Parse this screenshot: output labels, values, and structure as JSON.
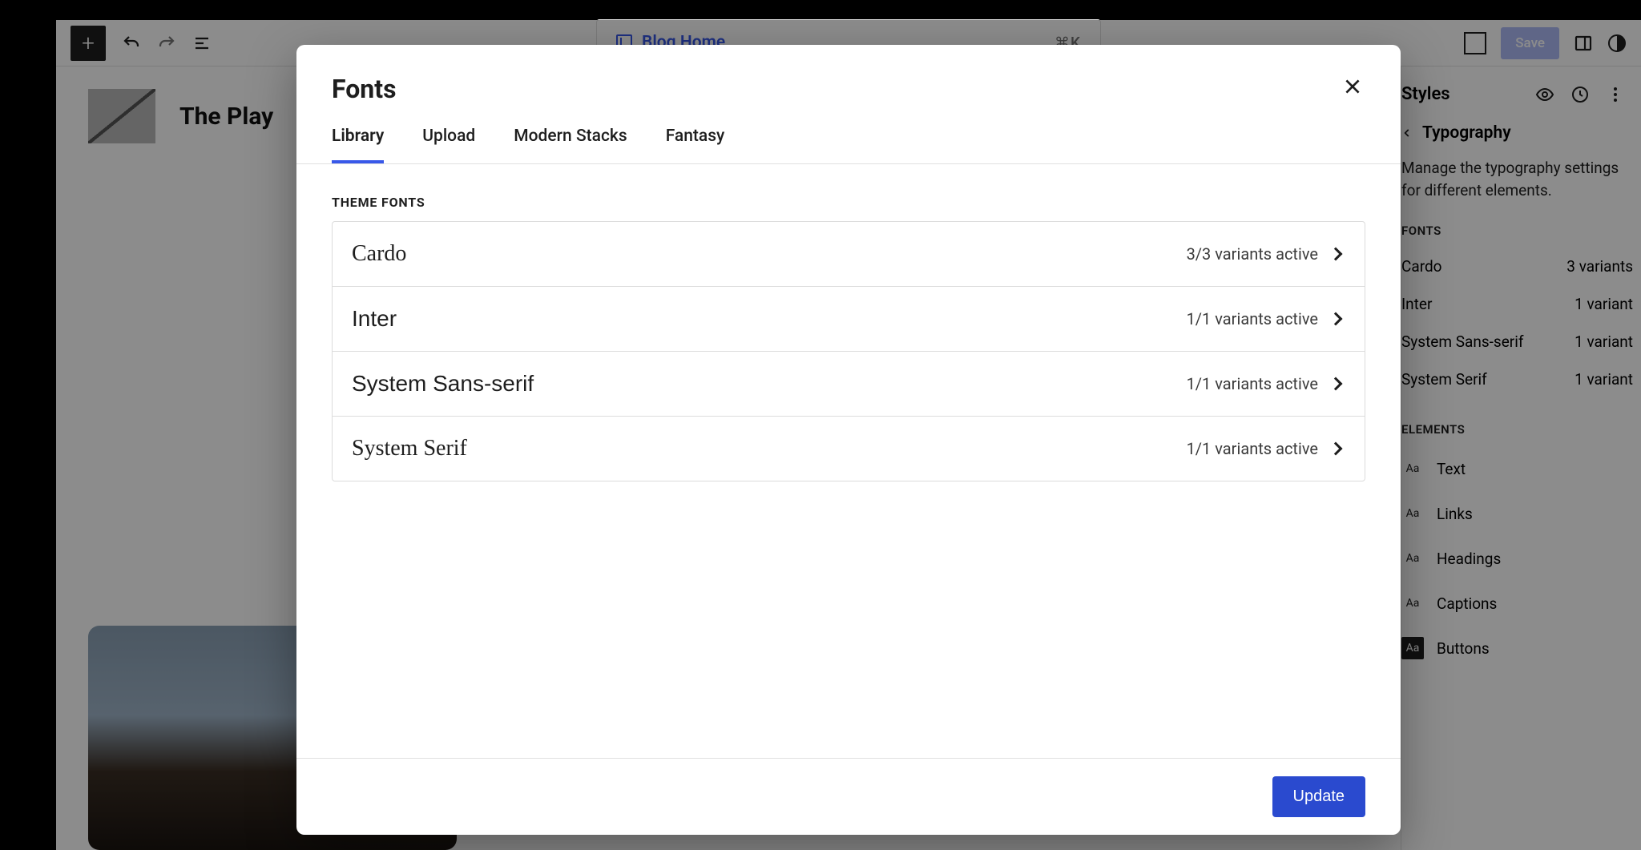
{
  "topbar": {
    "doc_title": "Blog Home",
    "shortcut": "⌘K",
    "save_label": "Save"
  },
  "canvas": {
    "site_title": "The Play"
  },
  "sidebar": {
    "panel_title": "Styles",
    "section_title": "Typography",
    "description": "Manage the typography settings for different elements.",
    "fonts_label": "FONTS",
    "fonts": [
      {
        "name": "Cardo",
        "meta": "3 variants"
      },
      {
        "name": "Inter",
        "meta": "1 variant"
      },
      {
        "name": "System Sans-serif",
        "meta": "1 variant"
      },
      {
        "name": "System Serif",
        "meta": "1 variant"
      }
    ],
    "elements_label": "ELEMENTS",
    "elements": [
      "Text",
      "Links",
      "Headings",
      "Captions",
      "Buttons"
    ]
  },
  "modal": {
    "title": "Fonts",
    "tabs": [
      "Library",
      "Upload",
      "Modern Stacks",
      "Fantasy"
    ],
    "active_tab": 0,
    "group_label": "THEME FONTS",
    "fonts": [
      {
        "name": "Cardo",
        "css": "f-cardo",
        "meta": "3/3 variants active"
      },
      {
        "name": "Inter",
        "css": "f-inter",
        "meta": "1/1 variants active"
      },
      {
        "name": "System Sans-serif",
        "css": "f-sans",
        "meta": "1/1 variants active"
      },
      {
        "name": "System Serif",
        "css": "f-serif",
        "meta": "1/1 variants active"
      }
    ],
    "update_label": "Update"
  }
}
